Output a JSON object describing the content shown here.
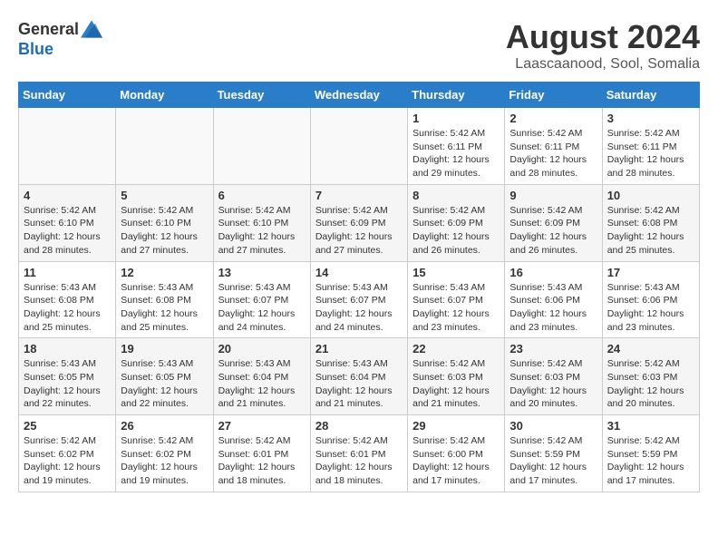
{
  "header": {
    "logo_general": "General",
    "logo_blue": "Blue",
    "month_title": "August 2024",
    "location": "Laascaanood, Sool, Somalia"
  },
  "weekdays": [
    "Sunday",
    "Monday",
    "Tuesday",
    "Wednesday",
    "Thursday",
    "Friday",
    "Saturday"
  ],
  "weeks": [
    [
      {
        "day": "",
        "info": ""
      },
      {
        "day": "",
        "info": ""
      },
      {
        "day": "",
        "info": ""
      },
      {
        "day": "",
        "info": ""
      },
      {
        "day": "1",
        "info": "Sunrise: 5:42 AM\nSunset: 6:11 PM\nDaylight: 12 hours\nand 29 minutes."
      },
      {
        "day": "2",
        "info": "Sunrise: 5:42 AM\nSunset: 6:11 PM\nDaylight: 12 hours\nand 28 minutes."
      },
      {
        "day": "3",
        "info": "Sunrise: 5:42 AM\nSunset: 6:11 PM\nDaylight: 12 hours\nand 28 minutes."
      }
    ],
    [
      {
        "day": "4",
        "info": "Sunrise: 5:42 AM\nSunset: 6:10 PM\nDaylight: 12 hours\nand 28 minutes."
      },
      {
        "day": "5",
        "info": "Sunrise: 5:42 AM\nSunset: 6:10 PM\nDaylight: 12 hours\nand 27 minutes."
      },
      {
        "day": "6",
        "info": "Sunrise: 5:42 AM\nSunset: 6:10 PM\nDaylight: 12 hours\nand 27 minutes."
      },
      {
        "day": "7",
        "info": "Sunrise: 5:42 AM\nSunset: 6:09 PM\nDaylight: 12 hours\nand 27 minutes."
      },
      {
        "day": "8",
        "info": "Sunrise: 5:42 AM\nSunset: 6:09 PM\nDaylight: 12 hours\nand 26 minutes."
      },
      {
        "day": "9",
        "info": "Sunrise: 5:42 AM\nSunset: 6:09 PM\nDaylight: 12 hours\nand 26 minutes."
      },
      {
        "day": "10",
        "info": "Sunrise: 5:42 AM\nSunset: 6:08 PM\nDaylight: 12 hours\nand 25 minutes."
      }
    ],
    [
      {
        "day": "11",
        "info": "Sunrise: 5:43 AM\nSunset: 6:08 PM\nDaylight: 12 hours\nand 25 minutes."
      },
      {
        "day": "12",
        "info": "Sunrise: 5:43 AM\nSunset: 6:08 PM\nDaylight: 12 hours\nand 25 minutes."
      },
      {
        "day": "13",
        "info": "Sunrise: 5:43 AM\nSunset: 6:07 PM\nDaylight: 12 hours\nand 24 minutes."
      },
      {
        "day": "14",
        "info": "Sunrise: 5:43 AM\nSunset: 6:07 PM\nDaylight: 12 hours\nand 24 minutes."
      },
      {
        "day": "15",
        "info": "Sunrise: 5:43 AM\nSunset: 6:07 PM\nDaylight: 12 hours\nand 23 minutes."
      },
      {
        "day": "16",
        "info": "Sunrise: 5:43 AM\nSunset: 6:06 PM\nDaylight: 12 hours\nand 23 minutes."
      },
      {
        "day": "17",
        "info": "Sunrise: 5:43 AM\nSunset: 6:06 PM\nDaylight: 12 hours\nand 23 minutes."
      }
    ],
    [
      {
        "day": "18",
        "info": "Sunrise: 5:43 AM\nSunset: 6:05 PM\nDaylight: 12 hours\nand 22 minutes."
      },
      {
        "day": "19",
        "info": "Sunrise: 5:43 AM\nSunset: 6:05 PM\nDaylight: 12 hours\nand 22 minutes."
      },
      {
        "day": "20",
        "info": "Sunrise: 5:43 AM\nSunset: 6:04 PM\nDaylight: 12 hours\nand 21 minutes."
      },
      {
        "day": "21",
        "info": "Sunrise: 5:43 AM\nSunset: 6:04 PM\nDaylight: 12 hours\nand 21 minutes."
      },
      {
        "day": "22",
        "info": "Sunrise: 5:42 AM\nSunset: 6:03 PM\nDaylight: 12 hours\nand 21 minutes."
      },
      {
        "day": "23",
        "info": "Sunrise: 5:42 AM\nSunset: 6:03 PM\nDaylight: 12 hours\nand 20 minutes."
      },
      {
        "day": "24",
        "info": "Sunrise: 5:42 AM\nSunset: 6:03 PM\nDaylight: 12 hours\nand 20 minutes."
      }
    ],
    [
      {
        "day": "25",
        "info": "Sunrise: 5:42 AM\nSunset: 6:02 PM\nDaylight: 12 hours\nand 19 minutes."
      },
      {
        "day": "26",
        "info": "Sunrise: 5:42 AM\nSunset: 6:02 PM\nDaylight: 12 hours\nand 19 minutes."
      },
      {
        "day": "27",
        "info": "Sunrise: 5:42 AM\nSunset: 6:01 PM\nDaylight: 12 hours\nand 18 minutes."
      },
      {
        "day": "28",
        "info": "Sunrise: 5:42 AM\nSunset: 6:01 PM\nDaylight: 12 hours\nand 18 minutes."
      },
      {
        "day": "29",
        "info": "Sunrise: 5:42 AM\nSunset: 6:00 PM\nDaylight: 12 hours\nand 17 minutes."
      },
      {
        "day": "30",
        "info": "Sunrise: 5:42 AM\nSunset: 5:59 PM\nDaylight: 12 hours\nand 17 minutes."
      },
      {
        "day": "31",
        "info": "Sunrise: 5:42 AM\nSunset: 5:59 PM\nDaylight: 12 hours\nand 17 minutes."
      }
    ]
  ]
}
